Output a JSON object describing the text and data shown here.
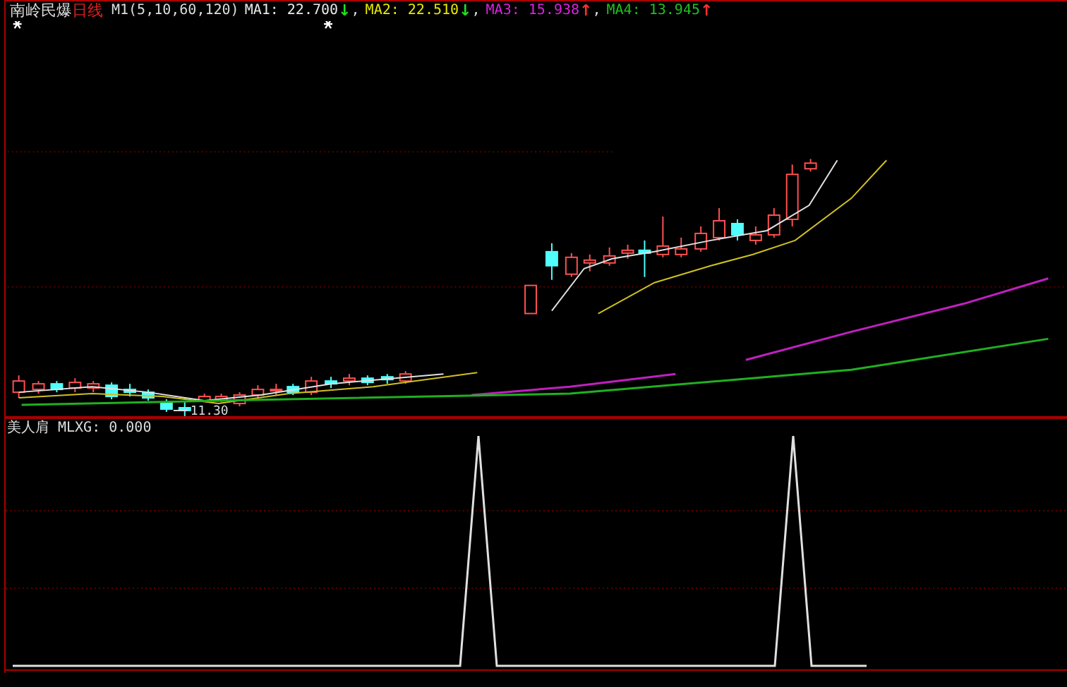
{
  "header": {
    "stock_name": "南岭民爆",
    "period": "日线",
    "indicator": "M1(5,10,60,120)",
    "averages": [
      {
        "label": "MA1: 22.700",
        "arrow": {
          "text": "↓",
          "color": "#20e020"
        },
        "color": "#e8e8e8",
        "separator": ","
      },
      {
        "label": "MA2: 22.510",
        "arrow": {
          "text": "↓",
          "color": "#20e020"
        },
        "color": "#e8e800",
        "separator": ","
      },
      {
        "label": "MA3: 15.938",
        "arrow": {
          "text": "↑",
          "color": "#ff3030"
        },
        "color": "#e020e0",
        "separator": ","
      },
      {
        "label": "MA4: 13.945",
        "arrow": {
          "text": "↑",
          "color": "#ff3030"
        },
        "color": "#20c020"
      }
    ]
  },
  "low_label": "11.30",
  "lower_panel": {
    "title": "美人肩",
    "reading": "MLXG: 0.000"
  }
}
